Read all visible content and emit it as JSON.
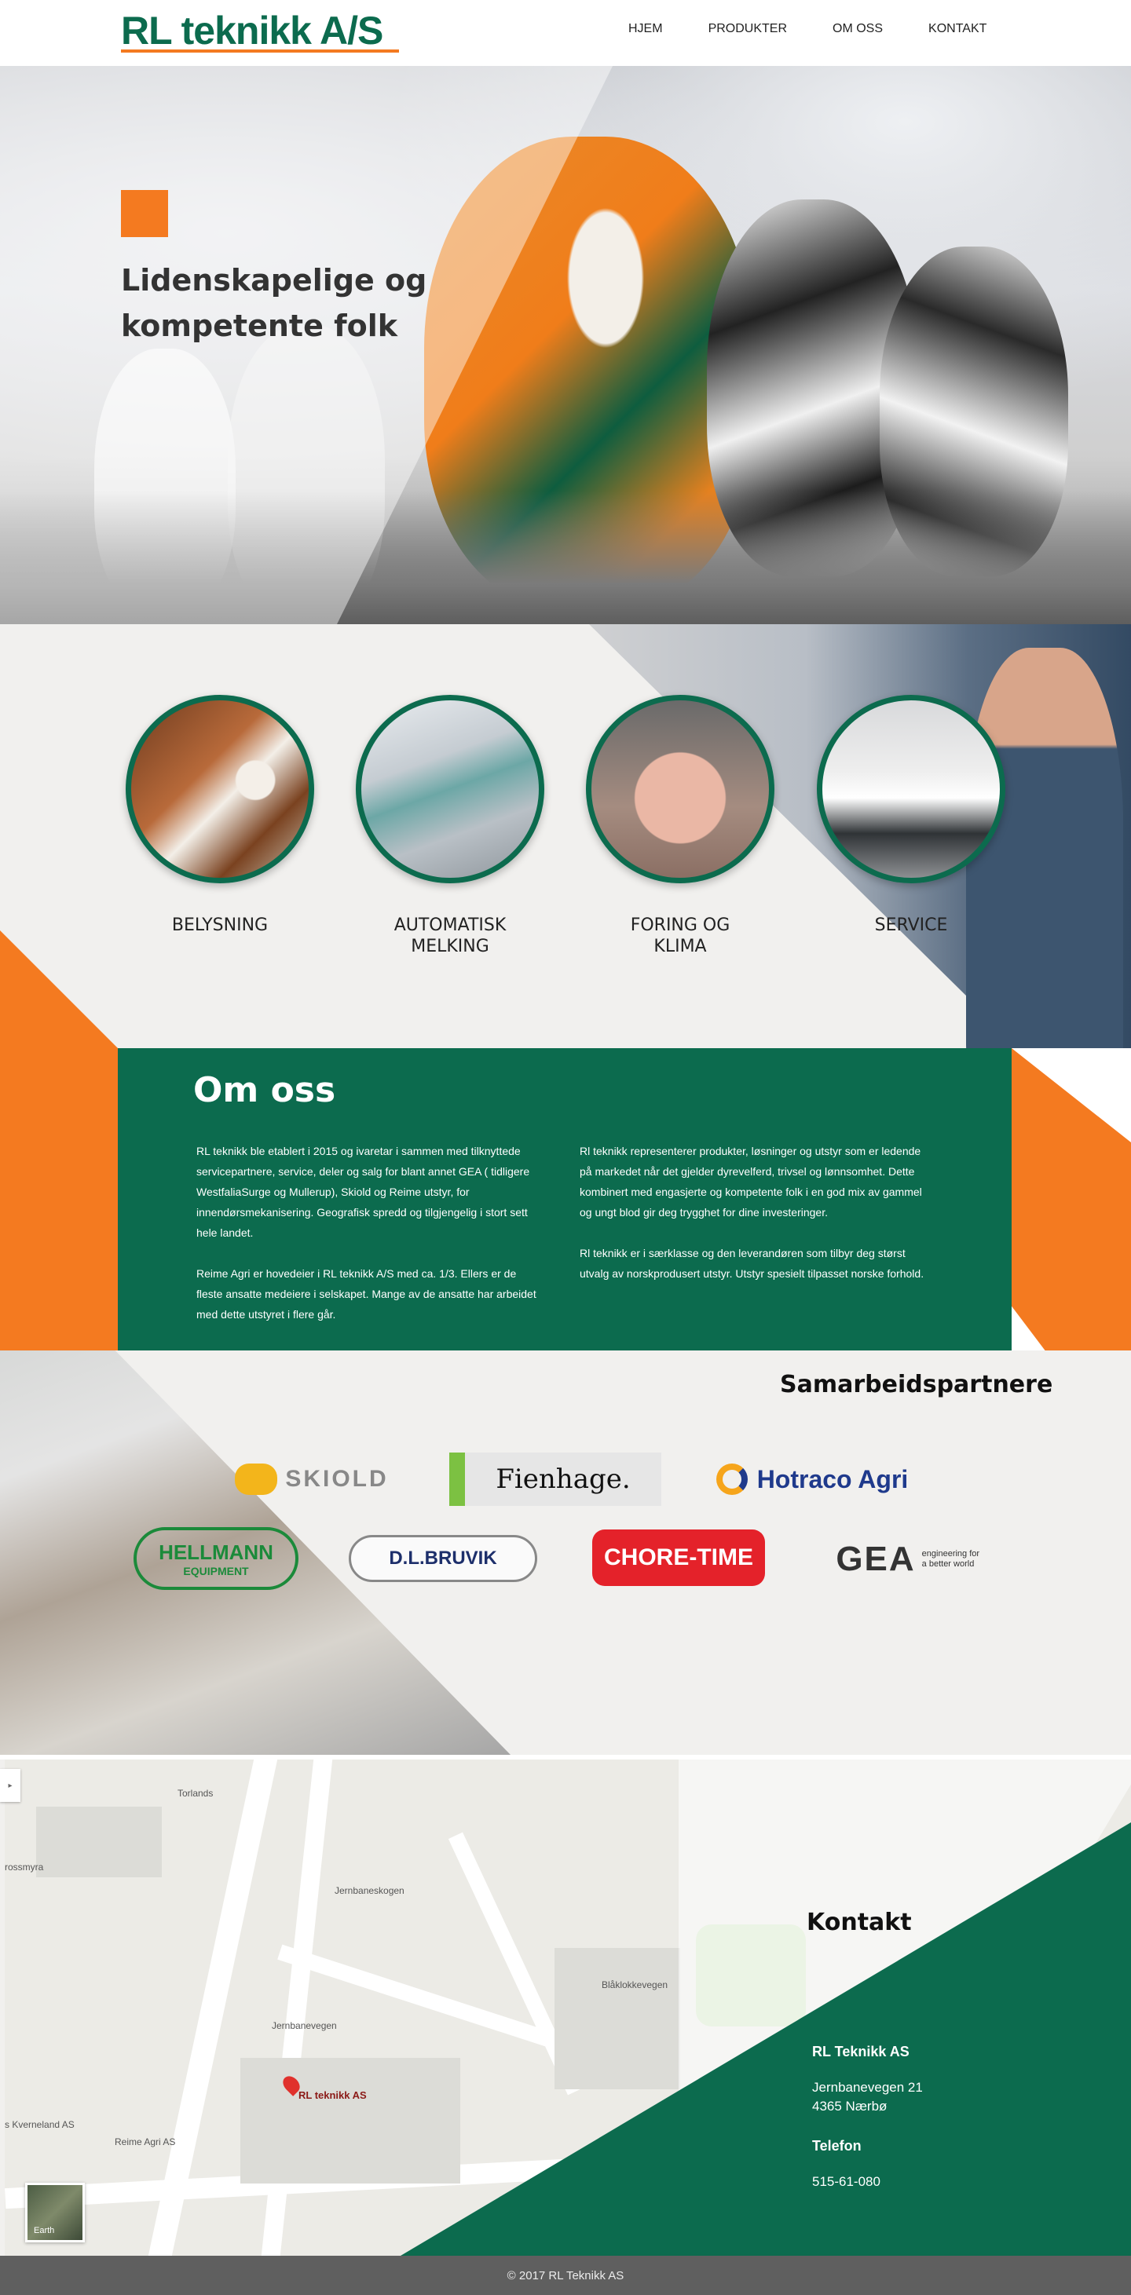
{
  "header": {
    "logo": "RL teknikk A/S",
    "nav": [
      "HJEM",
      "PRODUKTER",
      "OM OSS",
      "KONTAKT"
    ]
  },
  "hero": {
    "title": "Lidenskapelige og kompetente folk"
  },
  "services": [
    {
      "label_line1": "BELYSNING",
      "label_line2": ""
    },
    {
      "label_line1": "AUTOMATISK",
      "label_line2": "MELKING"
    },
    {
      "label_line1": "FORING OG",
      "label_line2": "KLIMA"
    },
    {
      "label_line1": "SERVICE",
      "label_line2": ""
    }
  ],
  "about": {
    "title": "Om oss",
    "left": [
      "RL teknikk ble etablert i 2015 og ivaretar i sammen med tilknyttede servicepartnere, service, deler og salg for blant annet GEA ( tidligere WestfaliaSurge og Mullerup), Skiold og Reime utstyr, for innendørsmekanisering.  Geografisk spredd og tilgjengelig i stort sett hele landet.",
      "Reime Agri er hovedeier i RL teknikk A/S med ca. 1/3.  Ellers er de fleste ansatte medeiere i selskapet.  Mange av de ansatte har arbeidet med dette utstyret i flere går."
    ],
    "right": [
      "Rl teknikk representerer produkter, løsninger og utstyr som er ledende på markedet når det gjelder dyrevelferd, trivsel og lønnsomhet. Dette kombinert med engasjerte og kompetente folk i en god mix av gammel og ungt blod gir deg trygghet for dine investeringer.",
      "Rl teknikk er i særklasse og den leverandøren som tilbyr deg størst utvalg av norskprodusert utstyr. Utstyr spesielt tilpasset norske forhold."
    ]
  },
  "partners": {
    "title": "Samarbeidspartnere",
    "logos": {
      "skiold": "SKIOLD",
      "fienhage": "Fienhage.",
      "hotraco": "Hotraco Agri",
      "hellmann": "HELLMANN",
      "hellmann_sub": "EQUIPMENT",
      "bruvik": "D.L.BRUVIK",
      "choretime": "CHORE-TIME",
      "gea": "GEA",
      "gea_tag": "engineering for a better world"
    }
  },
  "map": {
    "pin_label": "RL teknikk AS",
    "labels": [
      "Reime Agri AS",
      "s Kverneland AS",
      "Jernbaneskogen",
      "Jernbanevegen",
      "Blåklokkevegen",
      "Torlands",
      "rossmyra"
    ],
    "earth_label": "Earth"
  },
  "contact": {
    "title": "Kontakt",
    "company": "RL Teknikk AS",
    "address_line1": "Jernbanevegen 21",
    "address_line2": "4365 Nærbø",
    "phone_heading": "Telefon",
    "phone": "515-61-080"
  },
  "footer": {
    "text": "© 2017 RL Teknikk AS"
  },
  "colors": {
    "brand_green": "#0c6b4e",
    "brand_orange": "#f47a20"
  }
}
